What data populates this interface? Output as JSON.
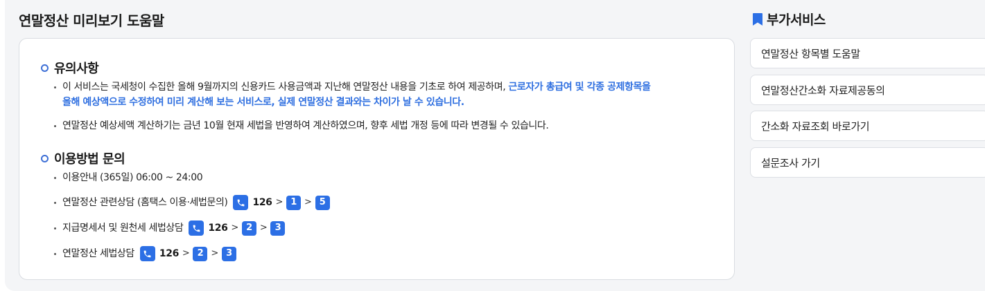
{
  "help": {
    "title": "연말정산 미리보기 도움말",
    "notice": {
      "heading": "유의사항",
      "item1_plain": "이 서비스는 국세청이 수집한 올해 9월까지의 신용카드 사용금액과 지난해 연말정산 내용을 기초로 하여 제공하며, ",
      "item1_line1_highlight": "근로자가 총급여 및 각종 공제항목을",
      "item1_line2_highlight": "올해 예상액으로 수정하여 미리 계산해 보는 서비스로, 실제 연말정산 결과와는 차이가 날 수 있습니다.",
      "item2": "연말정산 예상세액 계산하기는 금년 10월 현재 세법을 반영하여 계산하였으며, 향후 세법 개정 등에 따라 변경될 수 있습니다."
    },
    "usage": {
      "heading": "이용방법 문의",
      "hours": "이용안내 (365일) 06:00 ~ 24:00",
      "contacts": [
        {
          "label": "연말정산 관련상담 (홈택스 이용·세법문의)",
          "number": "126",
          "steps": [
            "1",
            "5"
          ]
        },
        {
          "label": "지급명세서 및 원천세 세법상담",
          "number": "126",
          "steps": [
            "2",
            "3"
          ]
        },
        {
          "label": "연말정산 세법상담",
          "number": "126",
          "steps": [
            "2",
            "3"
          ]
        }
      ],
      "arrow": ">"
    }
  },
  "extra": {
    "title": "부가서비스",
    "items": [
      {
        "label": "연말정산 항목별 도움말"
      },
      {
        "label": "연말정산간소화 자료제공동의"
      },
      {
        "label": "간소화 자료조회 바로가기"
      },
      {
        "label": "설문조사 가기"
      }
    ]
  },
  "colors": {
    "accent": "#2c6fe5",
    "highlight": "#2f6fe0",
    "background": "#f4f5f7"
  }
}
